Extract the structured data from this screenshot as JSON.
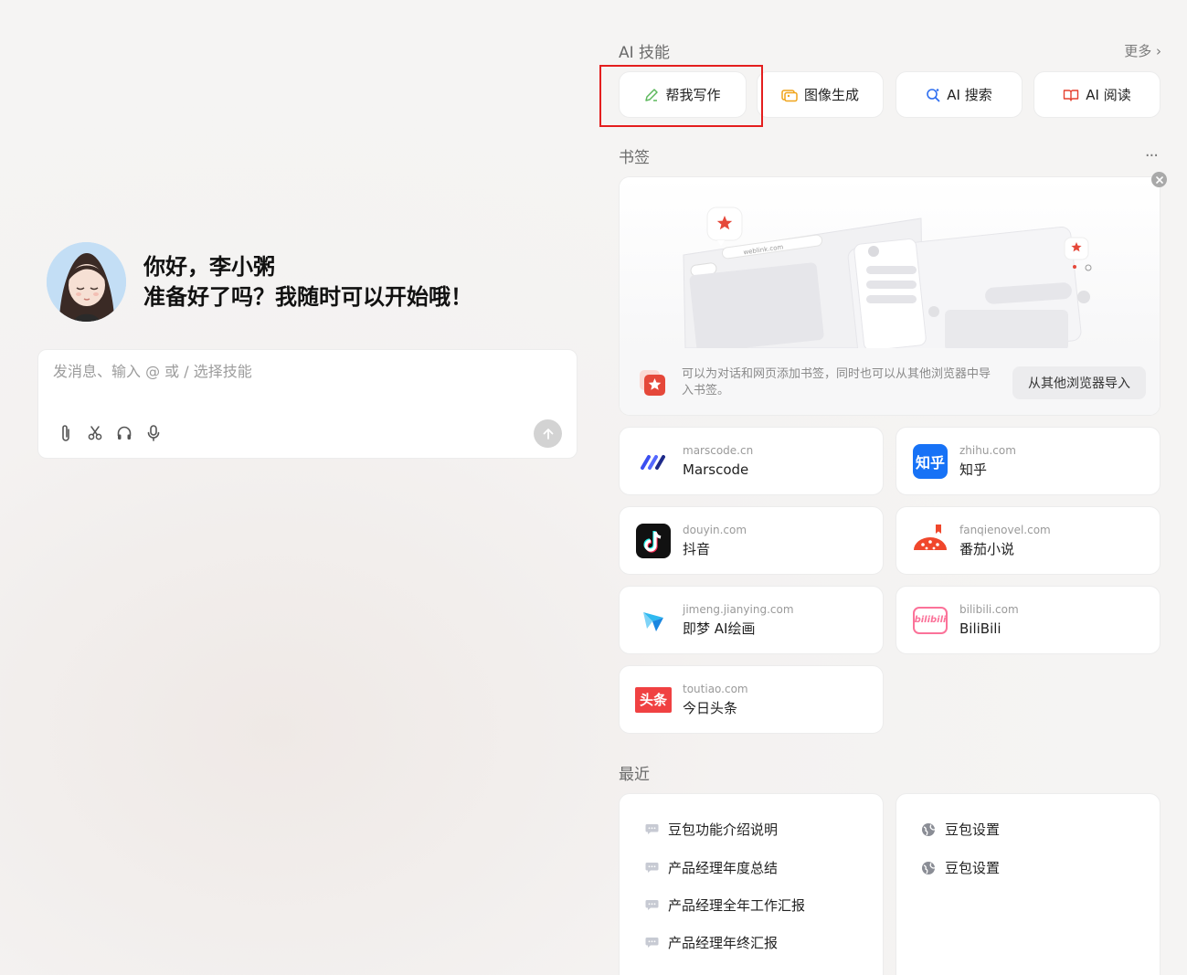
{
  "greeting": {
    "line1": "你好，李小粥",
    "line2": "准备好了吗？我随时可以开始哦！"
  },
  "chat": {
    "placeholder": "发消息、输入 @ 或 / 选择技能",
    "tools": [
      "paperclip-icon",
      "scissors-icon",
      "headphones-icon",
      "microphone-icon"
    ],
    "send_icon": "arrow-up-icon"
  },
  "skills": {
    "title": "AI 技能",
    "more": "更多 ›",
    "items": [
      {
        "label": "帮我写作",
        "icon": "pen-icon",
        "color": "#5cb85c"
      },
      {
        "label": "图像生成",
        "icon": "image-icon",
        "color": "#f0a41a"
      },
      {
        "label": "AI 搜索",
        "icon": "search-icon",
        "color": "#2f6ff0"
      },
      {
        "label": "AI 阅读",
        "icon": "book-icon",
        "color": "#e5402f"
      }
    ],
    "highlight_color": "#e41e1e"
  },
  "bookmarks": {
    "title": "书签",
    "menu": "···",
    "illus_url": "weblink.com",
    "hint": "可以为对话和网页添加书签，同时也可以从其他浏览器中导入书签。",
    "import_label": "从其他浏览器导入",
    "sites": [
      {
        "domain": "marscode.cn",
        "name": "Marscode",
        "logo": "marscode-logo"
      },
      {
        "domain": "zhihu.com",
        "name": "知乎",
        "logo": "zhihu-logo",
        "logo_text": "知乎"
      },
      {
        "domain": "douyin.com",
        "name": "抖音",
        "logo": "douyin-logo"
      },
      {
        "domain": "fanqienovel.com",
        "name": "番茄小说",
        "logo": "fanqie-logo"
      },
      {
        "domain": "jimeng.jianying.com",
        "name": "即梦 AI绘画",
        "logo": "jimeng-logo"
      },
      {
        "domain": "bilibili.com",
        "name": "BiliBili",
        "logo": "bilibili-logo",
        "logo_text": "bilibili"
      },
      {
        "domain": "toutiao.com",
        "name": "今日头条",
        "logo": "toutiao-logo",
        "logo_text": "头条"
      }
    ]
  },
  "recent": {
    "title": "最近",
    "chats": [
      "豆包功能介绍说明",
      "产品经理年度总结",
      "产品经理全年工作汇报",
      "产品经理年终汇报"
    ],
    "settings": [
      "豆包设置",
      "豆包设置"
    ]
  }
}
